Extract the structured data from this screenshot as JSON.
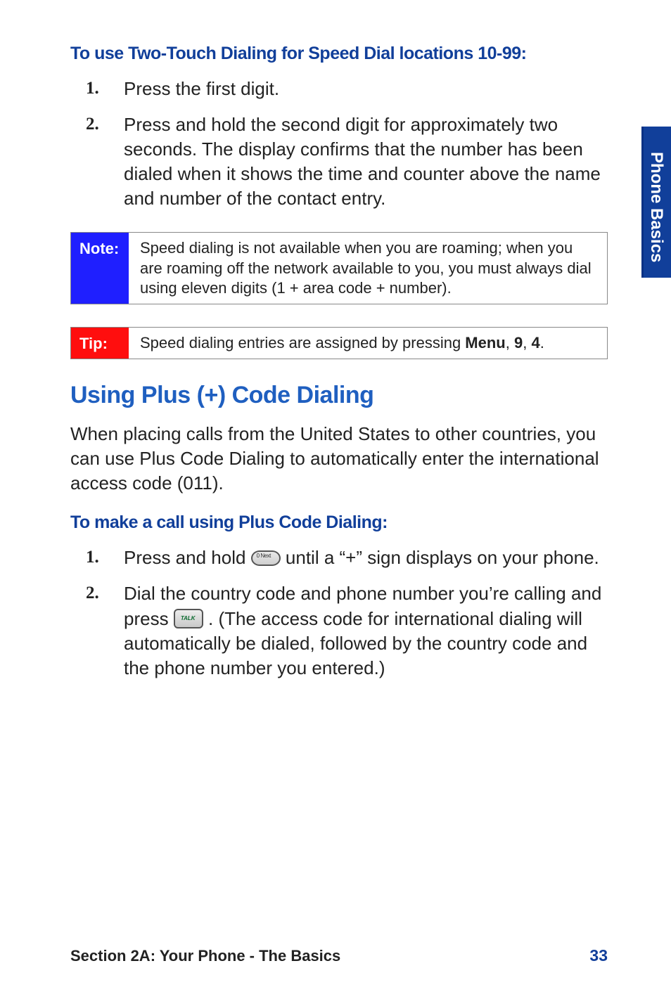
{
  "sideTab": "Phone Basics",
  "subhead1": "To use Two-Touch Dialing for Speed Dial locations 10-99:",
  "steps1": [
    "Press the first digit.",
    "Press and hold the second digit for approximately two seconds. The display confirms that the number has been dialed when it shows the time and counter above the name and number of the contact entry."
  ],
  "note": {
    "tag": "Note:",
    "body": "Speed dialing is not available when you are roaming; when you are roaming off the network available to you, you must always dial using eleven digits (1 + area code + number)."
  },
  "tip": {
    "tag": "Tip:",
    "prefix": "Speed dialing entries are assigned by pressing ",
    "bold1": "Menu",
    "sep1": ", ",
    "bold2": "9",
    "sep2": ", ",
    "bold3": "4",
    "suffix": "."
  },
  "sectionTitle": "Using Plus (+) Code Dialing",
  "para1": "When placing calls from the United States to other countries, you can use Plus Code Dialing to automatically enter the international access code (011).",
  "subhead2": "To make a call using Plus Code Dialing:",
  "steps2": {
    "s1_a": "Press and hold ",
    "s1_b": " until a “+” sign displays on your phone.",
    "s2_a": "Dial the country code and phone number you’re calling and press ",
    "s2_b": ". (The access code for international dialing will automatically be dialed, followed by the country code and the phone number you entered.)"
  },
  "keyLabels": {
    "zero": "0 Next",
    "talk": "TALK"
  },
  "footer": {
    "section": "Section 2A: Your Phone - The Basics",
    "page": "33"
  }
}
